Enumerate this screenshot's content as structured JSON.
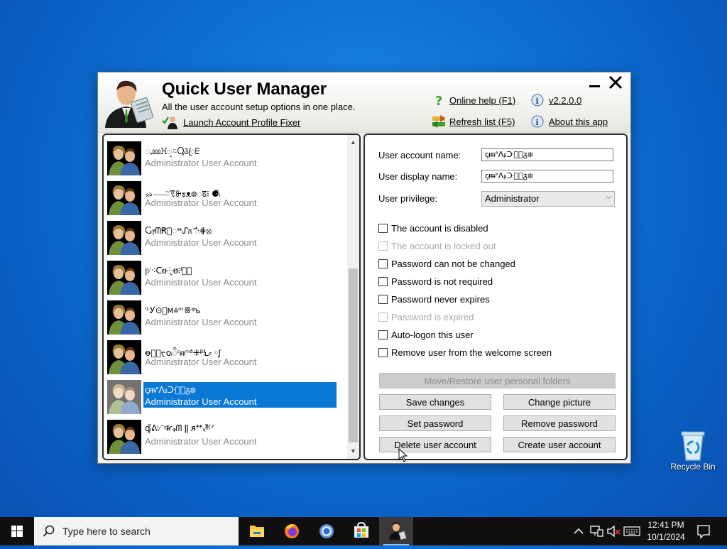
{
  "window": {
    "title": "Quick User Manager",
    "subtitle": "All the user account setup options in one place.",
    "fixer_link": "Launch Account Profile Fixer",
    "help_link": "Online help (F1)",
    "refresh_link": "Refresh list (F5)",
    "version_link": "v2.2.0.0",
    "about_link": "About this app"
  },
  "users": [
    {
      "name": "ꩻ⅏ꖾ᭬⍨Ⴓ꣓ꦿꗋ",
      "type": "Administrator User Account",
      "selected": false
    },
    {
      "name": "ᨋ⸺ᷓꗦꔬᢌᴥ᪥ꢿ⁝ ⚈᷈ᵢ",
      "type": "Administrator User Account",
      "selected": false
    },
    {
      "name": "Ⴚ᥅ᗰꞦ᪾ꢀᶧᔑᥰ ⸯ᪾᷉ᷠᐧ⋕⦻",
      "type": "Administrator User Account",
      "selected": false
    },
    {
      "name": "ꞁᜧ⁖ᑕᵿ⸭᷏ᵿ⁝ᑊᵬᷧ",
      "type": "Administrator User Account",
      "selected": false
    },
    {
      "name": "ꜝᴸᎩ⊙ᷓᴍ⩮ᵐꗥᵠꙏ",
      "type": "Administrator User Account",
      "selected": false
    },
    {
      "name": "ꝋ᪶ᷞᠸᴏᵢᬀᶜᵰᵐᶞ⁜ᵝꝆ⸗ ◦ᶘ",
      "type": "Administrator User Account",
      "selected": false
    },
    {
      "name": "ꞔᵯᐤᐱᵦᑞ᷐ᷟᵹ᪥",
      "type": "Administrator User Account",
      "selected": true
    },
    {
      "name": "ꝗᵢ᷉ᕕᜯᵞᵮꜥᵩᗰ ǁ ᴙᕯᵧᶲ᷈ᶴᐟ",
      "type": "Administrator User Account",
      "selected": false
    }
  ],
  "form": {
    "account_name_label": "User account name:",
    "account_name_value": "ꞔᵯᐤᐱᵦᑞ᷐ᷟᵹ᪥",
    "display_name_label": "User display name:",
    "display_name_value": "ꞔᵯᐤᐱᵦᑞ᷐ᷟᵹ᪥",
    "privilege_label": "User privilege:",
    "privilege_value": "Administrator"
  },
  "checkboxes": [
    {
      "label": "The account is disabled",
      "enabled": true,
      "checked": false
    },
    {
      "label": "The account is locked out",
      "enabled": false,
      "checked": false
    },
    {
      "label": "Password can not be changed",
      "enabled": true,
      "checked": false
    },
    {
      "label": "Password is not required",
      "enabled": true,
      "checked": false
    },
    {
      "label": "Password never expires",
      "enabled": true,
      "checked": false
    },
    {
      "label": "Password is expired",
      "enabled": false,
      "checked": false
    },
    {
      "label": "Auto-logon this user",
      "enabled": true,
      "checked": false
    },
    {
      "label": "Remove user from the welcome screen",
      "enabled": true,
      "checked": false
    }
  ],
  "buttons": {
    "move_restore": "Move/Restore user personal folders",
    "save": "Save changes",
    "change_picture": "Change picture",
    "set_password": "Set password",
    "remove_password": "Remove password",
    "delete_user": "Delete user account",
    "create_user": "Create user account"
  },
  "desktop": {
    "recycle_bin": "Recycle Bin"
  },
  "taskbar": {
    "search_placeholder": "Type here to search",
    "time": "12:41 PM",
    "date": "10/1/2024"
  },
  "icons": {
    "start": "windows-logo-icon",
    "search": "magnifier-icon",
    "apps": [
      "file-explorer-icon",
      "firefox-icon",
      "chrome-icon",
      "microsoft-store-icon",
      "quick-user-manager-icon"
    ],
    "tray": [
      "chevron-up-icon",
      "network-icon",
      "volume-muted-icon",
      "keyboard-icon",
      "notification-icon"
    ]
  },
  "colors": {
    "selection": "#0a78d7",
    "desktop": "#0f74d6",
    "taskbar": "#101010"
  }
}
